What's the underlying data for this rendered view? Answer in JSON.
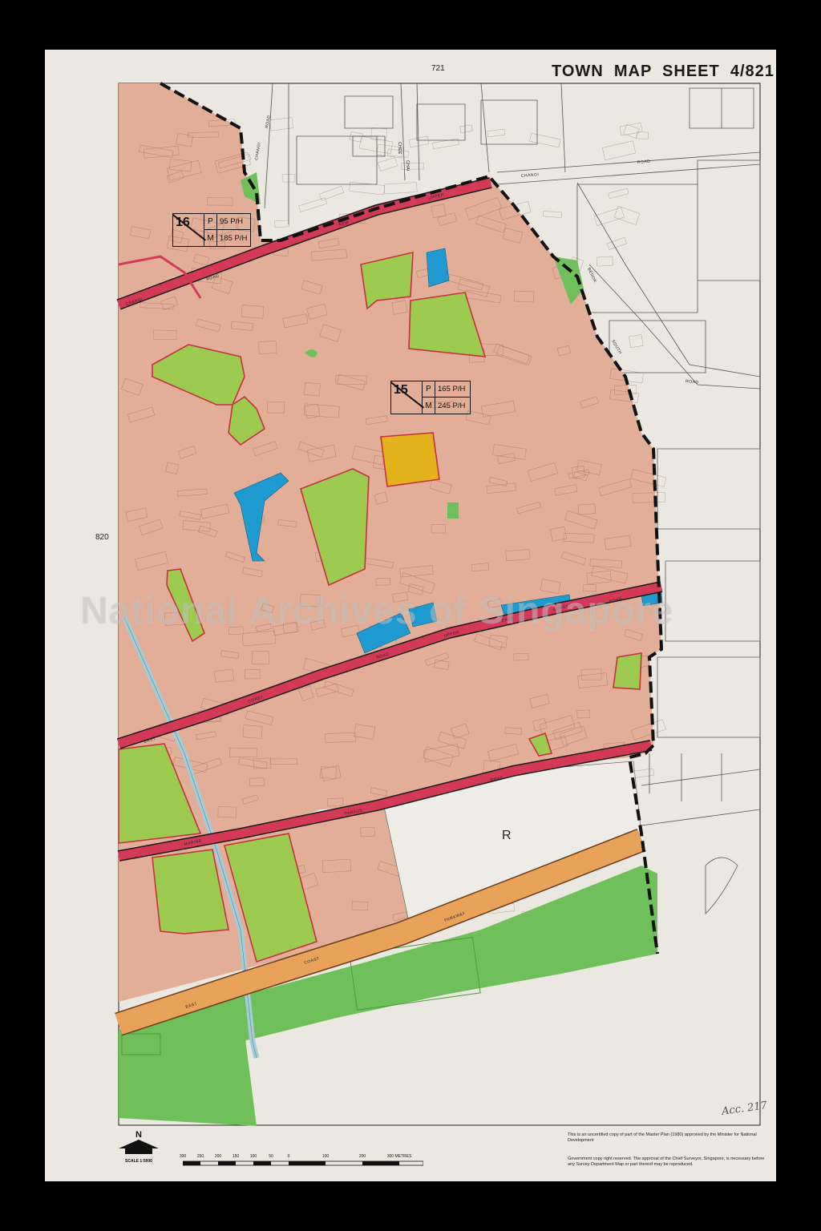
{
  "sheet": {
    "title": "TOWN  MAP  SHEET  4/821",
    "grid_top": "721",
    "grid_left": "820"
  },
  "zones": [
    {
      "number": "16",
      "p_label": "P",
      "p_value": "95 P/H",
      "m_label": "M",
      "m_value": "185 P/H"
    },
    {
      "number": "15",
      "p_label": "P",
      "p_value": "165 P/H",
      "m_label": "M",
      "m_value": "245 P/H"
    }
  ],
  "zone_letter": "R",
  "roads": {
    "changi_vertical": "CHANGI",
    "road_a": "ROAD",
    "chee": "CHEE",
    "chai": "CHAI",
    "changi_road": "CHANGI",
    "road_b": "ROAD",
    "upper": "UPPER",
    "new": "NEW",
    "changi_2": "CHANGI",
    "road_c": "ROAD",
    "bedok": "BEDOK",
    "south": "SOUTH",
    "road_d": "ROAD",
    "upper_2": "UPPER",
    "east": "EAST",
    "coast": "COAST",
    "road_e": "ROAD",
    "upper_3": "UPPER",
    "road_f": "ROAD",
    "east_2": "EAST",
    "coast_2": "COAST",
    "parade_marine": "MARINE",
    "parade": "PARADE",
    "road_g": "ROAD",
    "parkway": "PARKWAY",
    "coast_3": "COAST",
    "east_3": "EAST"
  },
  "legend": {
    "north": "N",
    "scale": "SCALE 1:5000",
    "scale_ticks": [
      "300",
      "250",
      "200",
      "150",
      "100",
      "50",
      "0",
      "100",
      "200",
      "300 METRES"
    ]
  },
  "notes": {
    "note1": "This is an uncertified copy of part of the Master Plan (1980) approved by the Minister for National Development",
    "note2": "Government copy right reserved. The approval of the Chief Surveyor, Singapore, is necessary before any Survey Department Map or part thereof may be reproduced."
  },
  "watermark": "National Archives of Singapore",
  "accession": "Acc. 217",
  "colors": {
    "residential": "#e3ae98",
    "open_space": "#9ccb4f",
    "park_green": "#6fbf5a",
    "civic_blue": "#1f9ad0",
    "school_yellow": "#e3b21c",
    "major_road": "#d43a58",
    "parkway": "#e9a25a",
    "canal": "#a6ccd6",
    "boundary": "#111111",
    "sheet_bg": "#ebe8e2"
  }
}
